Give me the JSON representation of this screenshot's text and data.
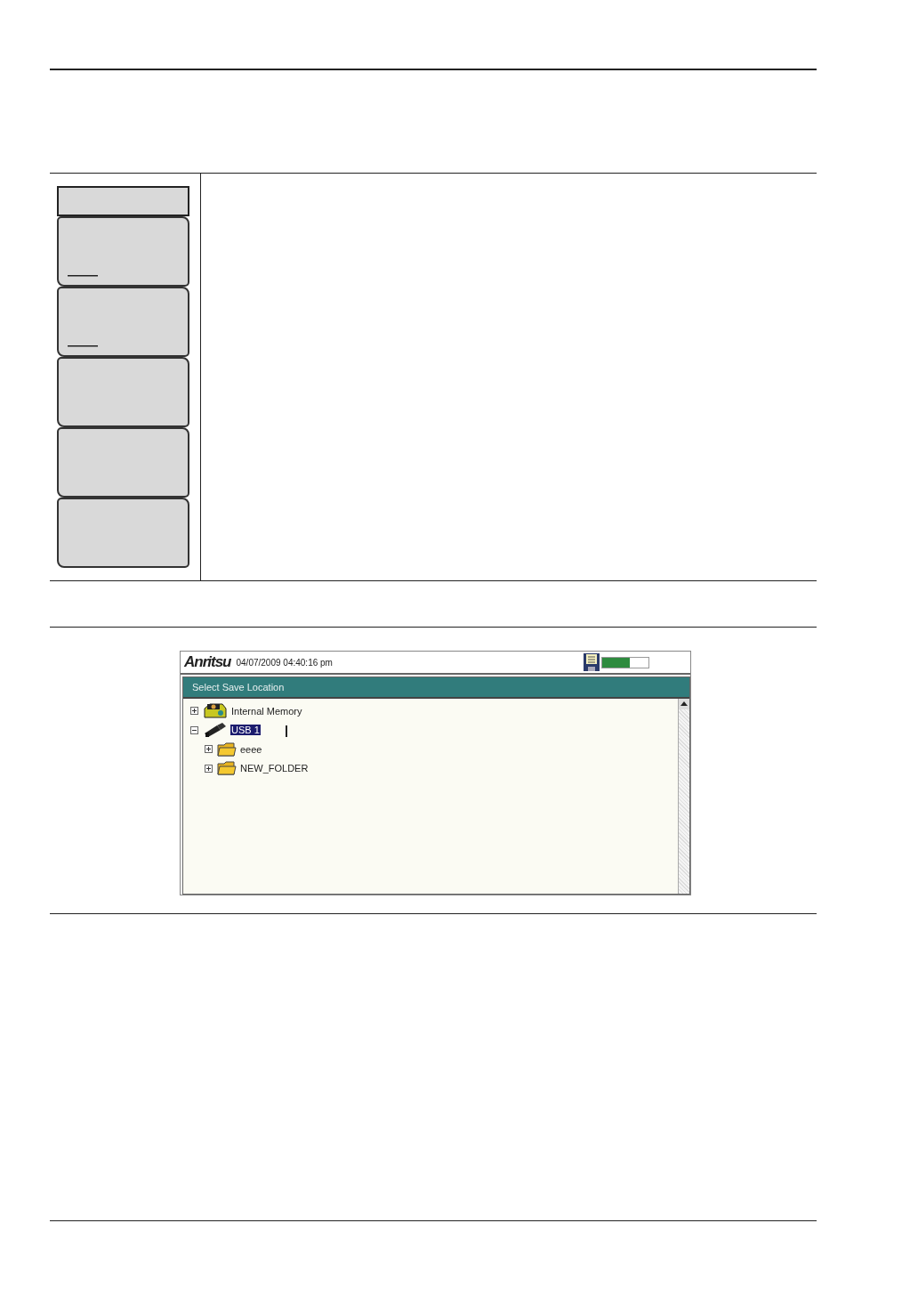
{
  "soft_key_menu": {
    "keys": [
      {
        "underlined": true
      },
      {
        "underlined": true
      },
      {
        "underlined": false
      },
      {
        "underlined": false
      },
      {
        "underlined": false
      }
    ]
  },
  "instrument_screen": {
    "logo": "Anritsu",
    "datetime": "04/07/2009 04:40:16 pm",
    "battery": {
      "level": 0.6
    },
    "dialog": {
      "title": "Select Save Location",
      "tree": [
        {
          "label": "Internal Memory",
          "kind": "drive",
          "expanded": false,
          "selected": false
        },
        {
          "label": "USB 1",
          "kind": "usb",
          "expanded": true,
          "selected": true,
          "children": [
            {
              "label": "eeee",
              "kind": "folder",
              "expanded": false,
              "selected": false
            },
            {
              "label": "NEW_FOLDER",
              "kind": "folder",
              "expanded": false,
              "selected": false
            }
          ]
        }
      ]
    }
  }
}
